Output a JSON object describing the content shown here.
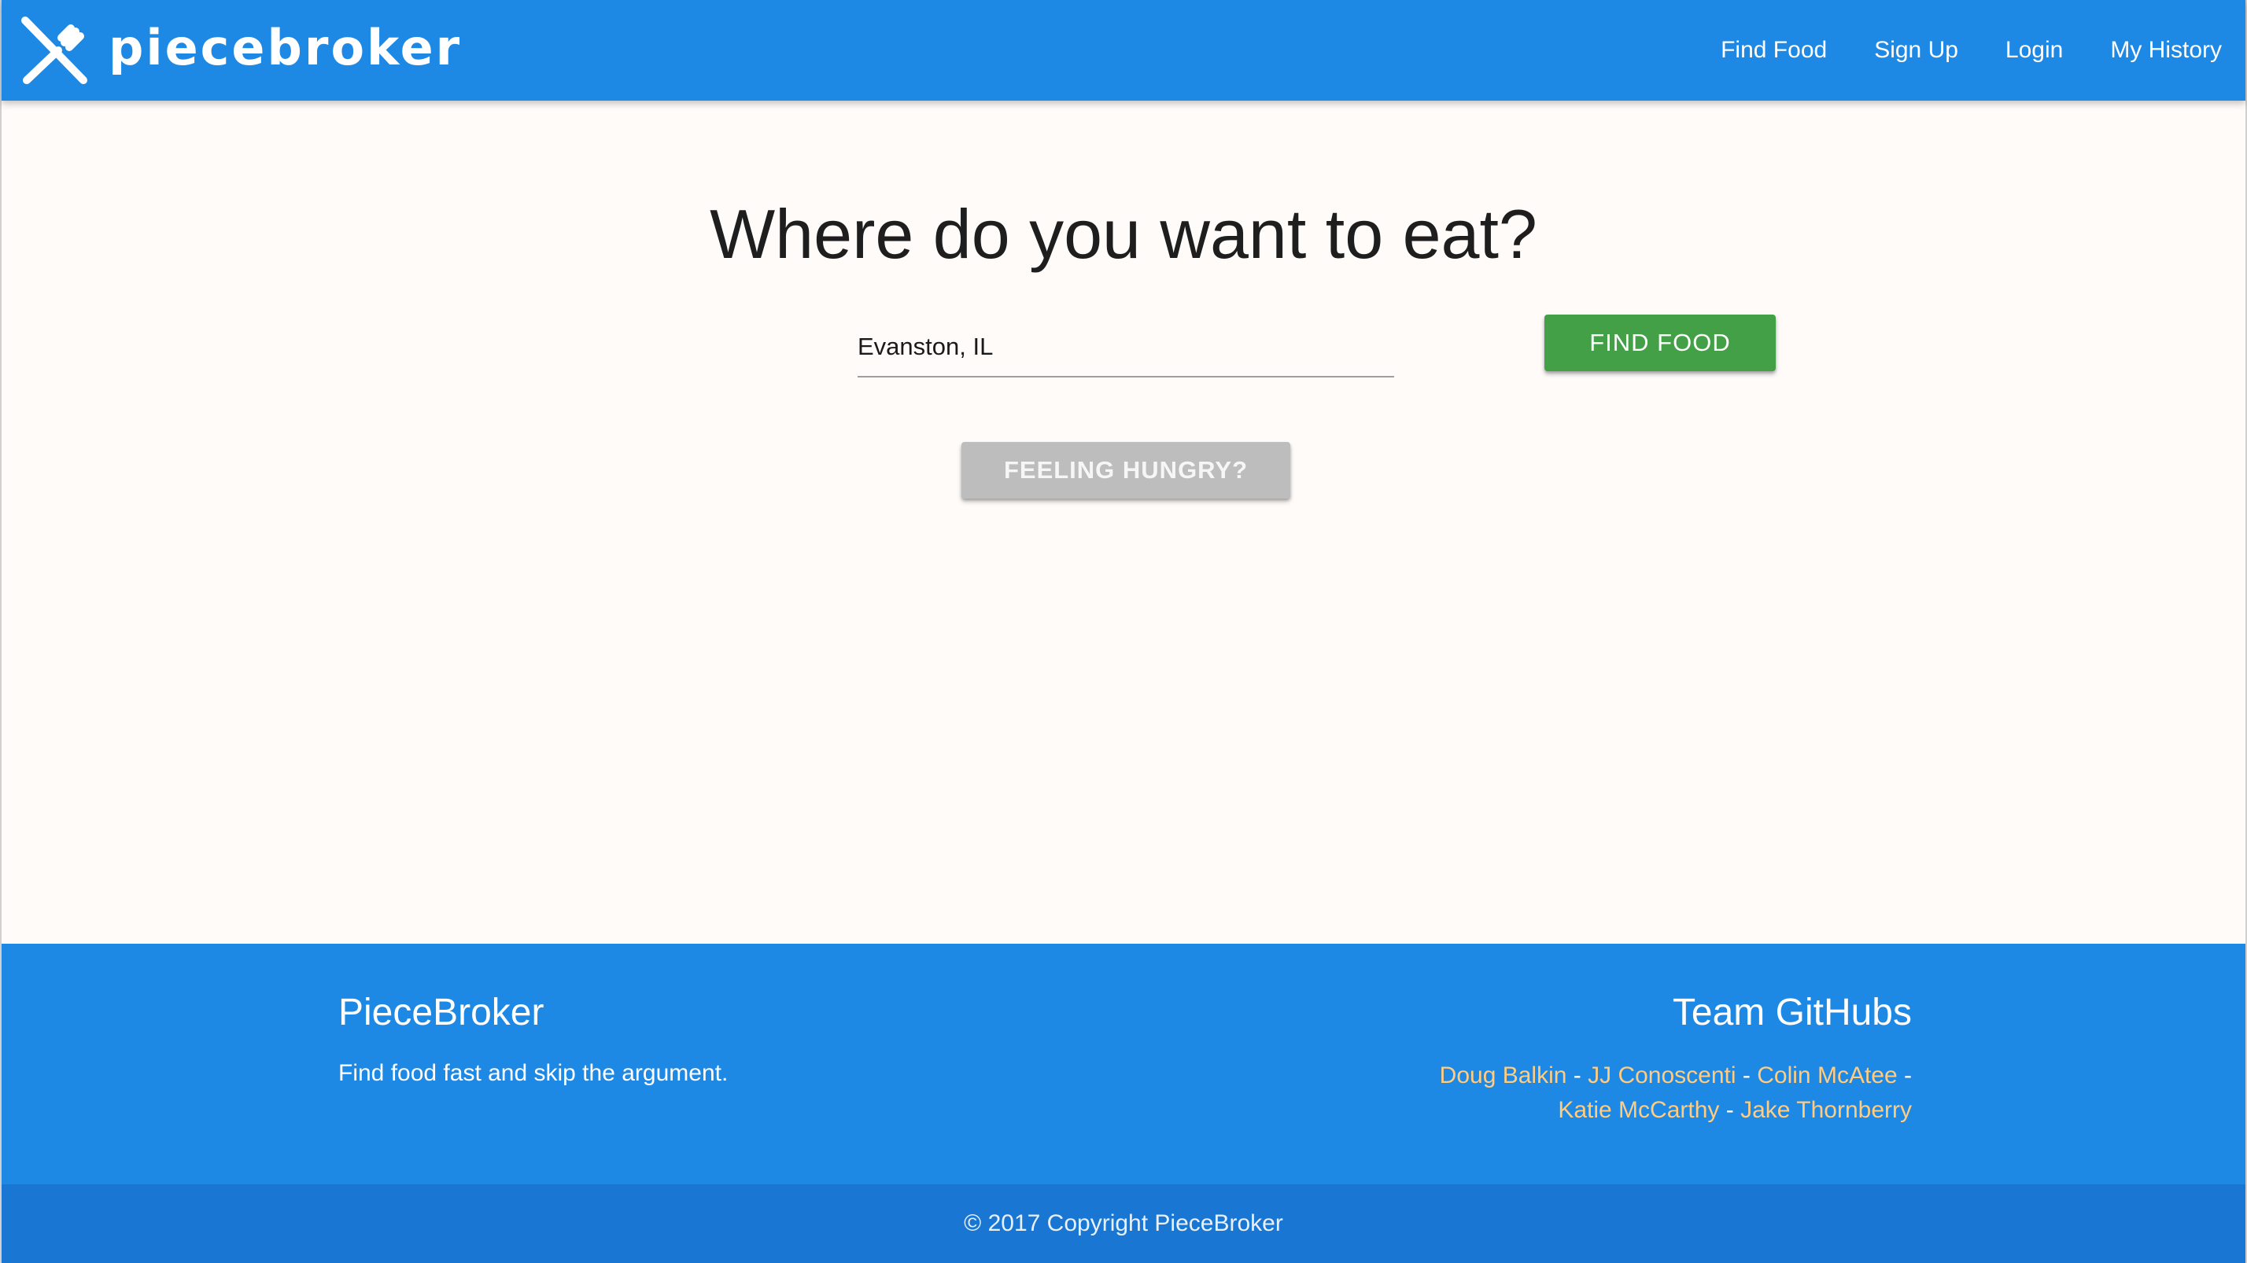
{
  "brand": {
    "name": "piecebroker",
    "logo_icon": "utensils-cross-icon"
  },
  "nav": {
    "items": [
      {
        "label": "Find Food"
      },
      {
        "label": "Sign Up"
      },
      {
        "label": "Login"
      },
      {
        "label": "My History"
      }
    ]
  },
  "main": {
    "title": "Where do you want to eat?",
    "location_value": "Evanston, IL",
    "find_food_label": "FIND FOOD",
    "feeling_hungry_label": "FEELING HUNGRY?"
  },
  "footer": {
    "title": "PieceBroker",
    "tagline": "Find food fast and skip the argument.",
    "team_title": "Team GitHubs",
    "members": [
      {
        "name": "Doug Balkin"
      },
      {
        "name": "JJ Conoscenti"
      },
      {
        "name": "Colin McAtee"
      },
      {
        "name": "Katie McCarthy"
      },
      {
        "name": "Jake Thornberry"
      }
    ],
    "separator": "-",
    "copyright": "© 2017 Copyright PieceBroker"
  },
  "colors": {
    "primary": "#1e88e5",
    "primary_dark": "#1976d2",
    "success": "#43a047",
    "disabled": "#bdbdbd",
    "link_accent": "#ffcc80",
    "background": "#fefbf9"
  }
}
